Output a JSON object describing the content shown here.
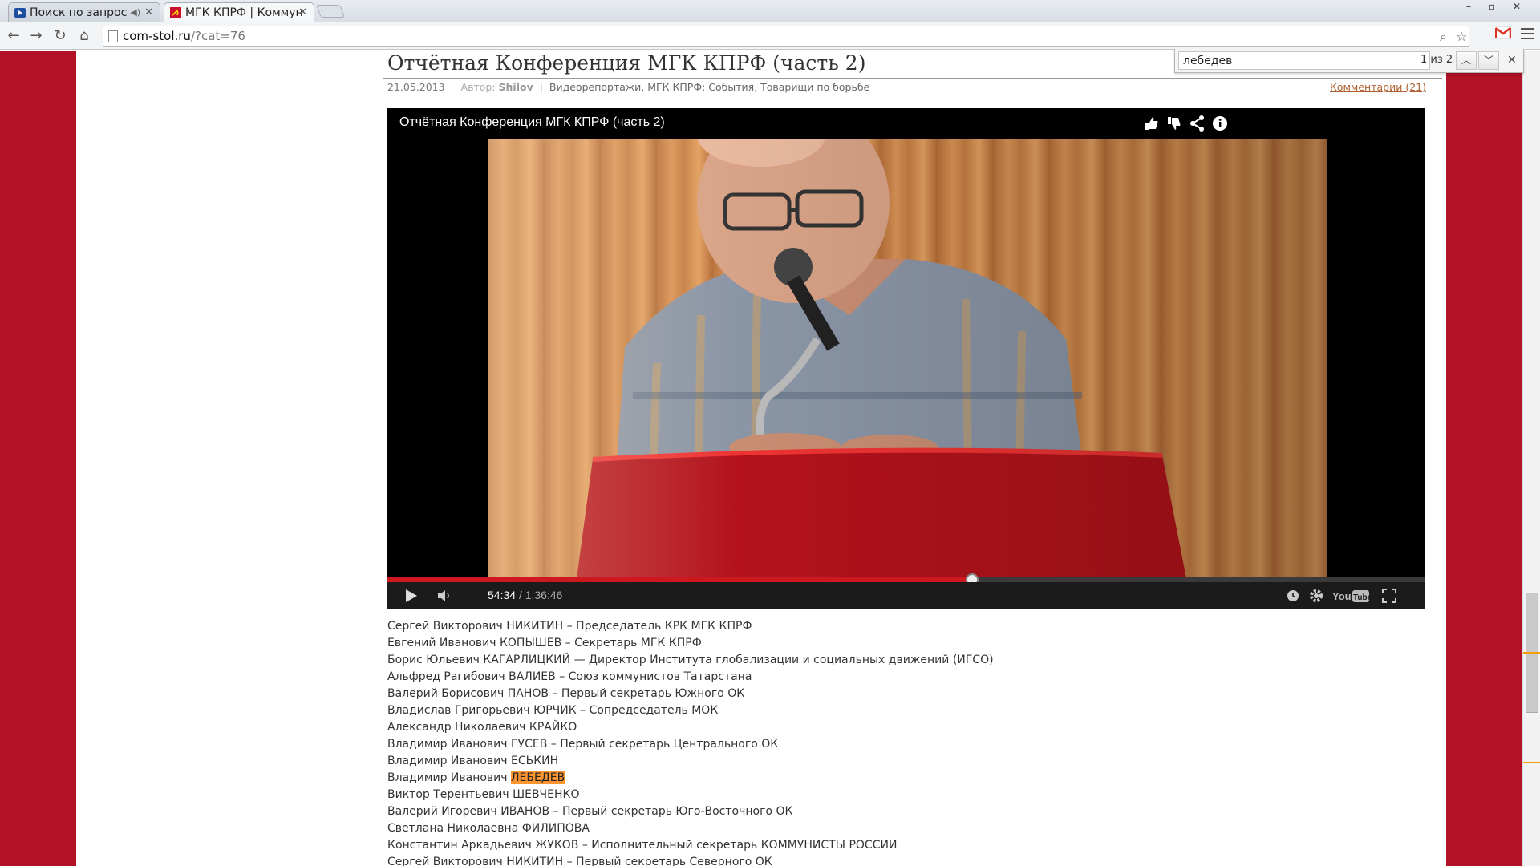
{
  "browser": {
    "tabs": [
      {
        "title": "Поиск по запрос",
        "state": "inactive"
      },
      {
        "title": "МГК КПРФ | Коммун",
        "state": "active"
      }
    ],
    "url_host": "com-stol.ru",
    "url_path": "/?cat=76",
    "window_controls": [
      "–",
      "▫",
      "✕"
    ],
    "accent_colors": {
      "page_background": "#b11226",
      "find_highlight": "#ff9632",
      "progress": "#cc181e"
    }
  },
  "find_bar": {
    "query": "лебедев",
    "count": "1 из 2"
  },
  "post": {
    "title": "Отчётная Конференция МГК КПРФ (часть 2)",
    "date": "21.05.2013",
    "author_label": "Автор:",
    "author": "Shilov",
    "categories": [
      "Видеорепортажи",
      "МГК КПРФ: События",
      "Товарищи по борьбе"
    ],
    "comments": "Комментарии (21)"
  },
  "video": {
    "title": "Отчётная Конференция МГК КПРФ (часть 2)",
    "current_time": "54:34",
    "duration": "/ 1:36:46",
    "progress_fraction": 0.563,
    "overlay_icons": [
      "thumbs-up-icon",
      "thumbs-down-icon",
      "share-icon",
      "info-icon"
    ],
    "control_icons": [
      "play-icon",
      "volume-icon",
      "watch-later-icon",
      "settings-icon",
      "youtube-logo",
      "fullscreen-icon"
    ]
  },
  "names": [
    {
      "text": "Сергей Викторович НИКИТИН – Председатель КРК МГК КПРФ"
    },
    {
      "text": "Евгений Иванович КОПЫШЕВ – Секретарь МГК КПРФ"
    },
    {
      "text": "Борис Юльевич КАГАРЛИЦКИЙ — Директор Института глобализации и социальных движений (ИГСО)"
    },
    {
      "text": "Альфред Рагибович ВАЛИЕВ – Союз коммунистов Татарстана"
    },
    {
      "text": "Валерий Борисович ПАНОВ – Первый секретарь Южного ОК"
    },
    {
      "text": "Владислав Григорьевич ЮРЧИК – Сопредседатель МОК"
    },
    {
      "text": "Александр Николаевич КРАЙКО"
    },
    {
      "text": "Владимир Иванович ГУСЕВ – Первый секретарь Центрального ОК"
    },
    {
      "text": "Владимир Иванович ЕСЬКИН"
    },
    {
      "prefix": "Владимир Иванович ",
      "highlight": "ЛЕБЕДЕВ"
    },
    {
      "text": "Виктор Терентьевич ШЕВЧЕНКО"
    },
    {
      "text": "Валерий Игоревич ИВАНОВ – Первый секретарь Юго-Восточного ОК"
    },
    {
      "text": "Светлана Николаевна ФИЛИПОВА"
    },
    {
      "text": "Константин Аркадьевич ЖУКОВ – Исполнительный секретарь КОММУНИСТЫ РОССИИ"
    },
    {
      "text": "Сергей Викторович НИКИТИН – Первый секретарь Северного ОК"
    }
  ]
}
